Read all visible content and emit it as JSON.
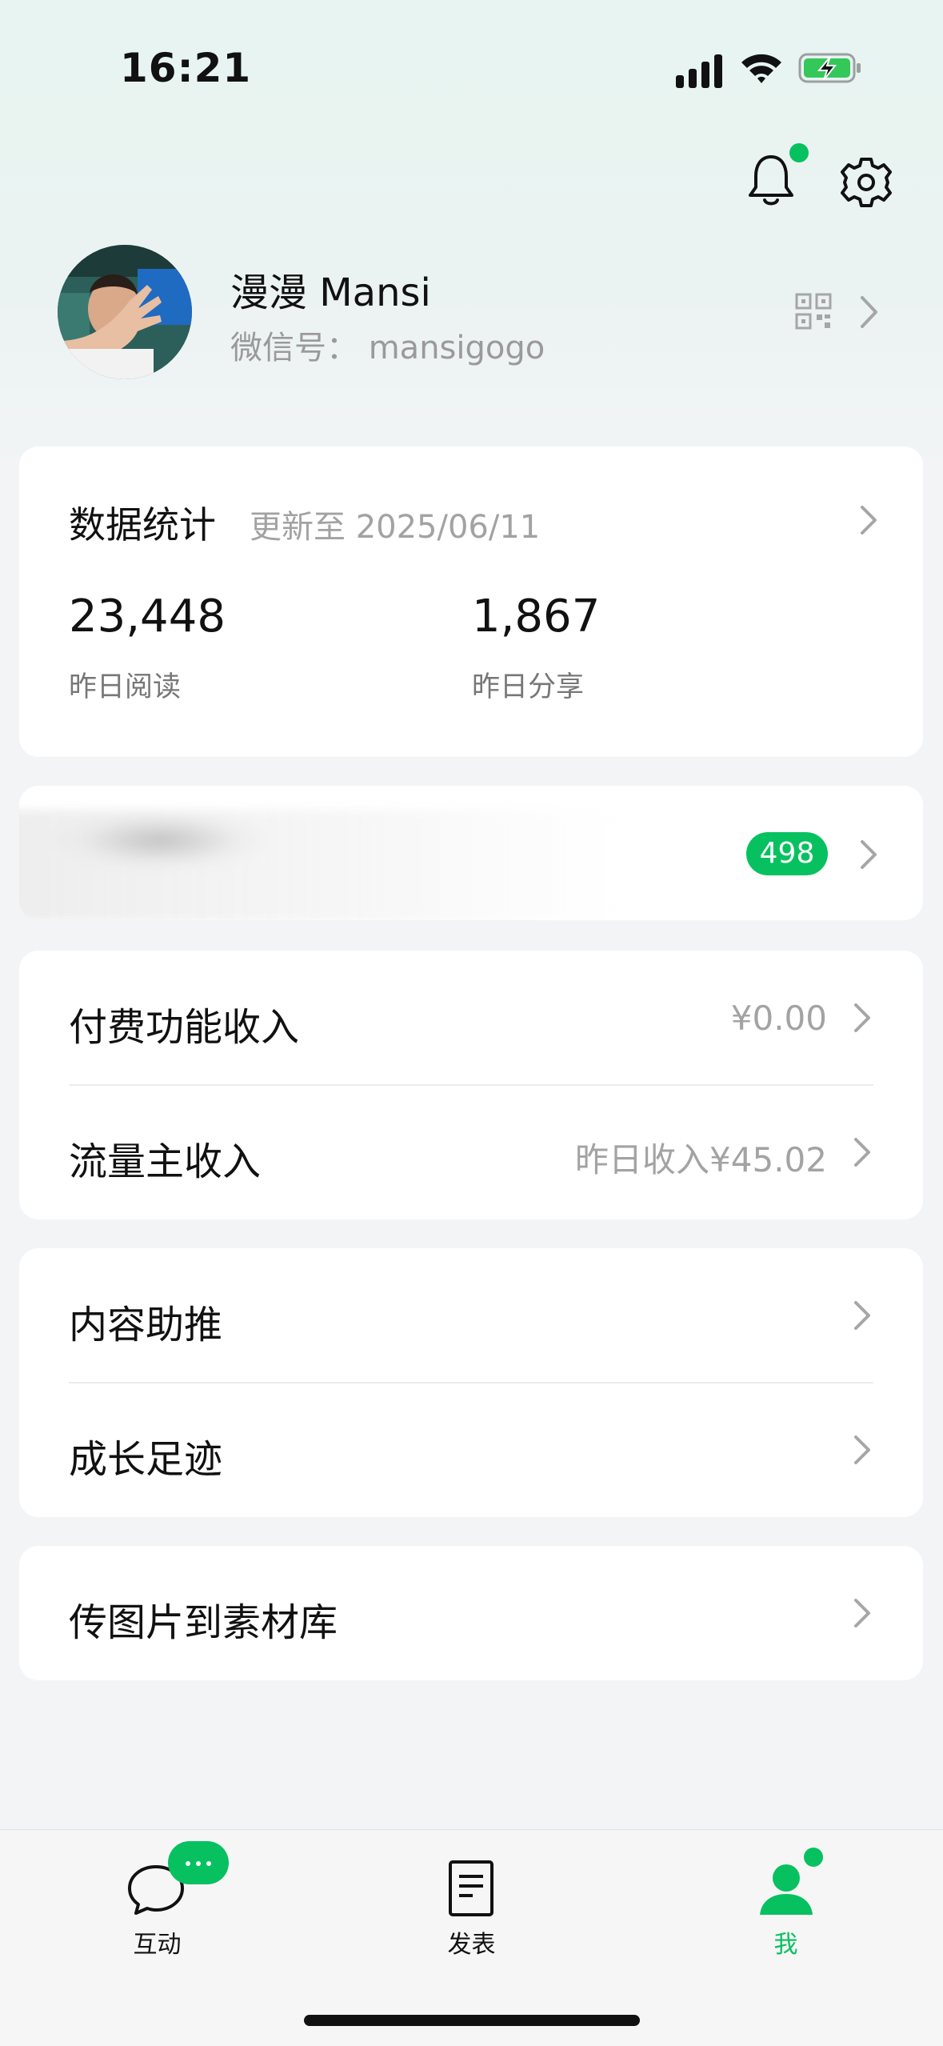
{
  "status_bar": {
    "time": "16:21"
  },
  "header": {
    "notification_dot": true
  },
  "profile": {
    "name": "漫漫 Mansi",
    "wechat_id": "微信号： mansigogo"
  },
  "stats": {
    "title": "数据统计",
    "updated": "更新至 2025/06/11",
    "items": [
      {
        "value": "23,448",
        "label": "昨日阅读"
      },
      {
        "value": "1,867",
        "label": "昨日分享"
      }
    ]
  },
  "blurred_row": {
    "badge": "498"
  },
  "income": [
    {
      "label": "付费功能收入",
      "value": "¥0.00"
    },
    {
      "label": "流量主收入",
      "value": "昨日收入¥45.02"
    }
  ],
  "growth": [
    {
      "label": "内容助推"
    },
    {
      "label": "成长足迹"
    }
  ],
  "upload": {
    "label": "传图片到素材库"
  },
  "tabbar": {
    "tabs": [
      {
        "label": "互动",
        "icon": "chat-bubble-icon"
      },
      {
        "label": "发表",
        "icon": "document-icon"
      },
      {
        "label": "我",
        "icon": "person-icon",
        "active": true
      }
    ]
  },
  "colors": {
    "accent": "#07c160",
    "background": "#f3f4f6"
  }
}
